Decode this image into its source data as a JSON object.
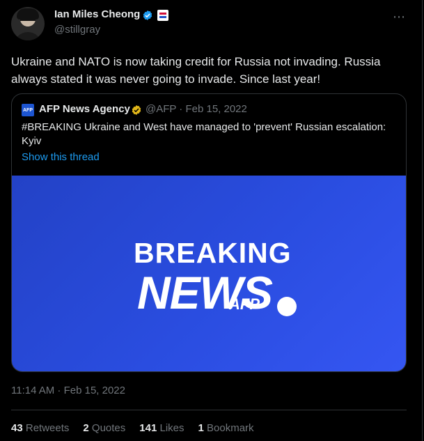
{
  "tweet": {
    "author_name": "Ian Miles Cheong",
    "author_handle": "@stillgray",
    "text": "Ukraine and NATO is now taking credit for Russia not invading. Russia always stated it was never going to invade. Since last year!",
    "timestamp": "11:14 AM · Feb 15, 2022",
    "more_icon": "⋯"
  },
  "quote": {
    "logo_text": "AFP",
    "author_name": "AFP News Agency",
    "meta": "@AFP · Feb 15, 2022",
    "text": "#BREAKING Ukraine and West have managed to 'prevent' Russian escalation: Kyiv",
    "link_text": "Show this thread",
    "image": {
      "line1": "BREAKING",
      "line2": "NEWS",
      "brand": "AFP"
    }
  },
  "stats": {
    "retweets_count": "43",
    "retweets_label": "Retweets",
    "quotes_count": "2",
    "quotes_label": "Quotes",
    "likes_count": "141",
    "likes_label": "Likes",
    "bookmarks_count": "1",
    "bookmarks_label": "Bookmark"
  },
  "colors": {
    "background": "#000000",
    "text": "#e7e9ea",
    "muted": "#71767b",
    "link": "#1d9bf0",
    "verified_blue": "#1d9bf0",
    "verified_gold": "#e2b719",
    "image_blue": "#2a4de0"
  }
}
